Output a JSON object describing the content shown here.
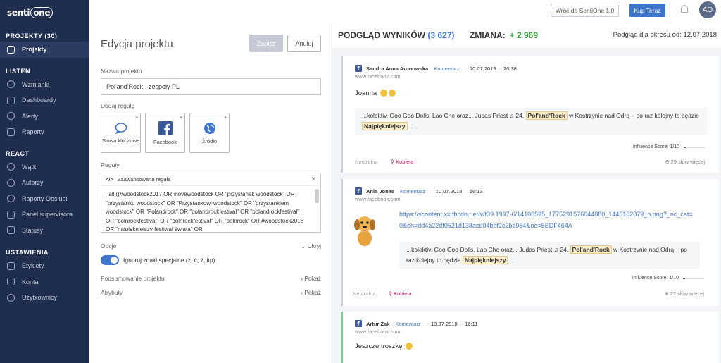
{
  "app": {
    "logo": "senti",
    "logo_suffix": "one"
  },
  "sidebar": {
    "sections": [
      {
        "title": "PROJEKTY (30)",
        "items": [
          {
            "label": "Projekty",
            "icon": "projects-icon",
            "active": true
          }
        ]
      },
      {
        "title": "LISTEN",
        "items": [
          {
            "label": "Wzmianki",
            "icon": "mentions-icon"
          },
          {
            "label": "Dashboardy",
            "icon": "dashboard-icon"
          },
          {
            "label": "Alerty",
            "icon": "alert-icon"
          },
          {
            "label": "Raporty",
            "icon": "reports-icon"
          }
        ]
      },
      {
        "title": "REACT",
        "items": [
          {
            "label": "Wątki",
            "icon": "threads-icon"
          },
          {
            "label": "Autorzy",
            "icon": "authors-icon"
          },
          {
            "label": "Raporty Obsługi",
            "icon": "service-reports-icon"
          },
          {
            "label": "Panel supervisora",
            "icon": "supervisor-icon"
          },
          {
            "label": "Statusy",
            "icon": "status-icon"
          }
        ]
      },
      {
        "title": "USTAWIENIA",
        "items": [
          {
            "label": "Etykiety",
            "icon": "tag-icon"
          },
          {
            "label": "Konta",
            "icon": "accounts-icon"
          },
          {
            "label": "Użytkownicy",
            "icon": "users-icon"
          }
        ]
      }
    ]
  },
  "topbar": {
    "back_label": "Wróć do SentiOne 1.0",
    "buy_label": "Kup Teraz",
    "avatar": "AO"
  },
  "edit": {
    "title": "Edycja projektu",
    "save_label": "Zapisz",
    "cancel_label": "Anuluj",
    "name_label": "Nazwa projektu",
    "name_value": "Pol'and'Rock - zespoły PL",
    "add_rule_label": "Dodaj regułę",
    "sources": [
      {
        "label": "Słowa kluczowe",
        "icon": "keywords-icon"
      },
      {
        "label": "Facebook",
        "icon": "facebook-icon"
      },
      {
        "label": "Źródło",
        "icon": "globe-icon"
      }
    ],
    "rules_label": "Reguły",
    "rule_title": "Zaawansowana reguła",
    "rule_code_icon": "</>",
    "rule_text": "_all:((#woodstock2017 OR #lovewoodstock OR \"przystanek woodstock\" OR \"przystanku woodstock\" OR \"Przystankowi woodstock\" OR \"przystankiem woodstock\" OR \"Polandrock\" OR \"polandrockfestival\" OR \"polandrockfestival\" OR \"polnrockfestival\" OR \"polnrockfestival\" OR \"polnrock\" OR #woodstock2018 OR \"najpiękniejszy festiwal świata\" OR",
    "options_label": "Opcje",
    "options_action": "Ukryj",
    "toggle_label": "Ignoruj znaki specjalne (ż, ć, ź, itp)",
    "summary_label": "Podsumowanie projektu",
    "summary_action": "Pokaż",
    "attributes_label": "Atrybuty",
    "attributes_action": "Pokaż"
  },
  "results": {
    "title": "PODGLĄD WYNIKÓW",
    "count": "(3 627)",
    "change_label": "ZMIANA:",
    "change_value": "+ 2 969",
    "period": "Podgląd dla okresu od: 12.07.2018",
    "cards": [
      {
        "author": "Sandra Anna Aronowska",
        "type": "Komentarz",
        "date": "10.07.2018",
        "time": "20:38",
        "url": "www.facebook.com",
        "text": "Joanna",
        "quote_pre": "...kolektiv, Goo Goo Dolls, Lao Che oraz... Judas Priest ♫ 24.",
        "quote_hl1": "Pol'and'Rock",
        "quote_mid": "w Kostrzynie nad Odrą – po raz kolejny to będzie",
        "quote_hl2": "Najpiękniejszy",
        "quote_post": "...",
        "influence": "Influence Score: 1/10",
        "influence_value": 1,
        "sentiment": "Neutralna",
        "gender": "Kobieta",
        "more": "29 słów więcej"
      },
      {
        "author": "Ania Jonas",
        "type": "Komentarz",
        "date": "10.07.2018",
        "time": "16:13",
        "url": "www.facebook.com",
        "link": "https://scontent.xx.fbcdn.net/v/t39.1997-6/14106595_1775291576044880_1445182879_n.png?_nc_cat=0&oh=dd4a22df0521d138acd04bbf2c2ba954&oe=5BDF464A",
        "quote_pre": "...kolektiv, Goo Goo Dolls, Lao Che oraz... Judas Priest ♫ 24.",
        "quote_hl1": "Pol'and'Rock",
        "quote_mid": "w Kostrzynie nad Odrą – po raz kolejny to będzie",
        "quote_hl2": "Najpiękniejszy",
        "quote_post": "...",
        "influence": "Influence Score: 1/10",
        "influence_value": 1,
        "sentiment": "Neutralna",
        "gender": "Kobieta",
        "more": "27 słów więcej"
      },
      {
        "author": "Artur Żak",
        "type": "Komentarz",
        "date": "10.07.2018",
        "time": "16:11",
        "url": "www.facebook.com",
        "text": "Jeszcze troszkę"
      }
    ]
  },
  "colors": {
    "sidebar": "#1f2d4e",
    "accent": "#3e74c9",
    "positive": "#2f9d3a",
    "highlight": "#fbecc8"
  }
}
